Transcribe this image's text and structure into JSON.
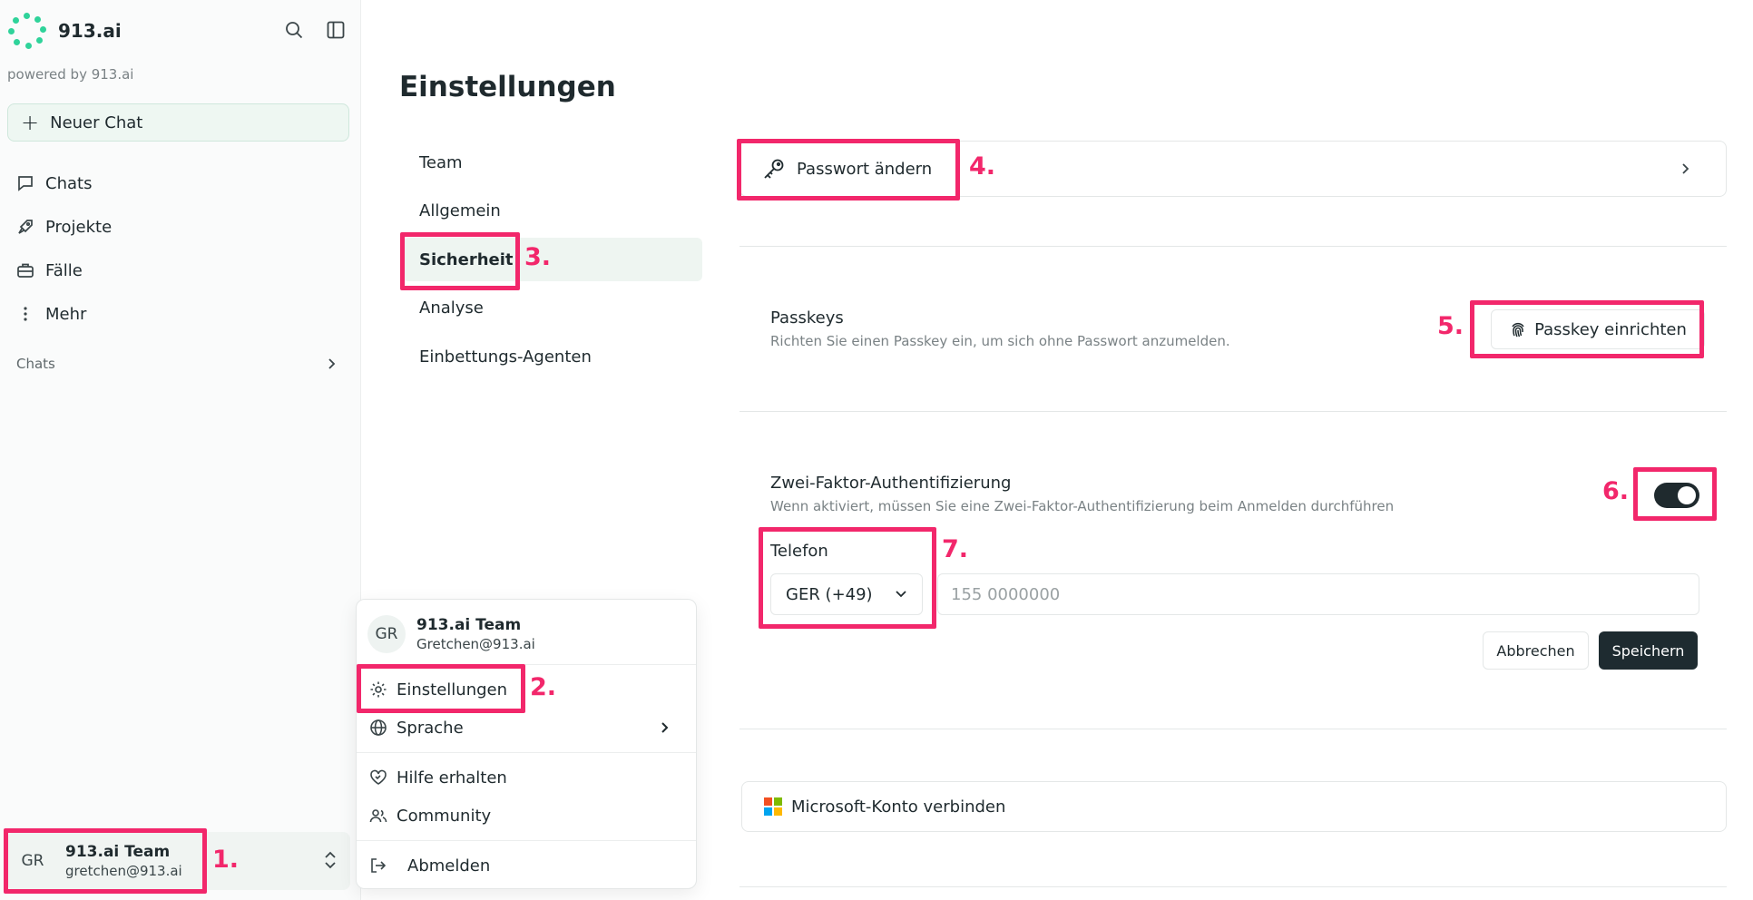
{
  "brand": {
    "name": "913.ai",
    "powered_by": "powered by 913.ai",
    "accent": "#2fd39a"
  },
  "sidebar": {
    "new_chat_label": "Neuer Chat",
    "items": [
      {
        "label": "Chats",
        "icon": "chat-bubble-icon"
      },
      {
        "label": "Projekte",
        "icon": "rocket-icon"
      },
      {
        "label": "Fälle",
        "icon": "briefcase-icon"
      },
      {
        "label": "Mehr",
        "icon": "more-vertical-icon"
      }
    ],
    "chats_section_label": "Chats"
  },
  "user": {
    "initials": "GR",
    "name": "913.ai Team",
    "email": "gretchen@913.ai",
    "email_menu": "Gretchen@913.ai"
  },
  "menu": {
    "settings": "Einstellungen",
    "language": "Sprache",
    "help": "Hilfe erhalten",
    "community": "Community",
    "logout": "Abmelden"
  },
  "settings": {
    "title": "Einstellungen",
    "tabs": [
      "Team",
      "Allgemein",
      "Sicherheit",
      "Analyse",
      "Einbettungs-Agenten"
    ],
    "active_tab": "Sicherheit"
  },
  "security": {
    "change_password": "Passwort ändern",
    "passkeys_title": "Passkeys",
    "passkeys_desc": "Richten Sie einen Passkey ein, um sich ohne Passwort anzumelden.",
    "passkey_button": "Passkey einrichten",
    "twofa_title": "Zwei-Faktor-Authentifizierung",
    "twofa_desc": "Wenn aktiviert, müssen Sie eine Zwei-Faktor-Authentifizierung beim Anmelden durchführen",
    "twofa_enabled": true,
    "phone_label": "Telefon",
    "country_code": "GER (+49)",
    "phone_placeholder": "155 0000000",
    "cancel": "Abbrechen",
    "save": "Speichern",
    "microsoft": "Microsoft-Konto verbinden"
  },
  "annotations": [
    "1.",
    "2.",
    "3.",
    "4.",
    "5.",
    "6.",
    "7."
  ],
  "colors": {
    "highlight": "#f2276b",
    "primary_dark": "#1e2b30"
  }
}
